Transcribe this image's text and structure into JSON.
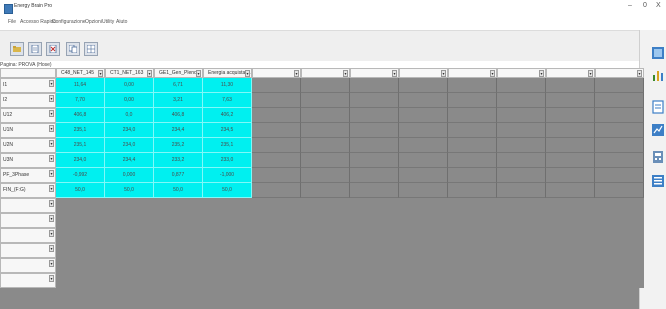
{
  "window": {
    "title": "Energy Brain Pro",
    "minimize_label": "–",
    "maximize_label": "0",
    "close_label": "X"
  },
  "menu": [
    "File",
    "Accesso Rapido",
    "Configurazione",
    "Opzioni",
    "Utility",
    "Aiuto"
  ],
  "toolbar": {
    "buttons": [
      "open-folder-icon",
      "document-icon",
      "close-document-icon",
      "copy-icon",
      "grid-icon"
    ]
  },
  "page": {
    "label": "Pagina: PROVA (Hose)"
  },
  "table": {
    "columns": [
      "C48_NET_145",
      "CT1_NET_163",
      "GE1_Gen_Pleno...",
      "Energia acquistat...",
      "",
      "",
      "",
      "",
      "",
      "",
      "",
      ""
    ],
    "rows": [
      {
        "label": "I1",
        "values": [
          "11,64",
          "0,00",
          "6,71",
          "11,30"
        ]
      },
      {
        "label": "I2",
        "values": [
          "7,70",
          "0,00",
          "3,21",
          "7,63"
        ]
      },
      {
        "label": "U12",
        "values": [
          "406,8",
          "0,0",
          "406,8",
          "406,2"
        ]
      },
      {
        "label": "U1N",
        "values": [
          "235,1",
          "234,0",
          "234,4",
          "234,5"
        ]
      },
      {
        "label": "U2N",
        "values": [
          "235,1",
          "234,0",
          "235,2",
          "235,1"
        ]
      },
      {
        "label": "U3N",
        "values": [
          "234,0",
          "234,4",
          "233,2",
          "233,0"
        ]
      },
      {
        "label": "PF_3Phase",
        "values": [
          "-0,992",
          "0,000",
          "0,877",
          "-1,000"
        ]
      },
      {
        "label": "FIN_(F:G)",
        "values": [
          "50,0",
          "50,0",
          "50,0",
          "50,0"
        ]
      }
    ],
    "empty_rows": 6,
    "dropdown_glyph": "▾",
    "fill_color": "#00f0f0"
  },
  "right_panel": {
    "icons": [
      "report-icon",
      "bar-chart-icon",
      "document-list-icon",
      "chart-document-icon",
      "calculator-icon",
      "notes-icon"
    ]
  }
}
